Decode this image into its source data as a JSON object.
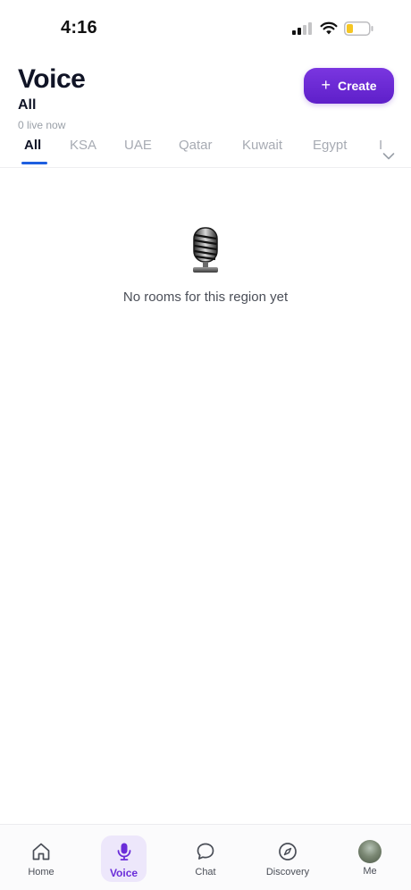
{
  "status_bar": {
    "time": "4:16"
  },
  "header": {
    "title": "Voice",
    "region": "All",
    "live_count": "0 live now",
    "create_label": "Create"
  },
  "tabs": [
    {
      "label": "All",
      "active": true
    },
    {
      "label": "KSA",
      "active": false
    },
    {
      "label": "UAE",
      "active": false
    },
    {
      "label": "Qatar",
      "active": false
    },
    {
      "label": "Kuwait",
      "active": false
    },
    {
      "label": "Egypt",
      "active": false
    },
    {
      "label": "I",
      "active": false
    }
  ],
  "empty_state": {
    "icon": "microphone-icon",
    "message": "No rooms for this region yet"
  },
  "bottom_nav": [
    {
      "label": "Home",
      "icon": "home-icon",
      "active": false
    },
    {
      "label": "Voice",
      "icon": "microphone-icon",
      "active": true
    },
    {
      "label": "Chat",
      "icon": "chat-bubble-icon",
      "active": false
    },
    {
      "label": "Discovery",
      "icon": "compass-icon",
      "active": false
    },
    {
      "label": "Me",
      "icon": "avatar",
      "active": false
    }
  ],
  "colors": {
    "accent": "#6a2dd9",
    "tab_underline": "#1e5fe0",
    "battery_level": "#f5c623"
  }
}
